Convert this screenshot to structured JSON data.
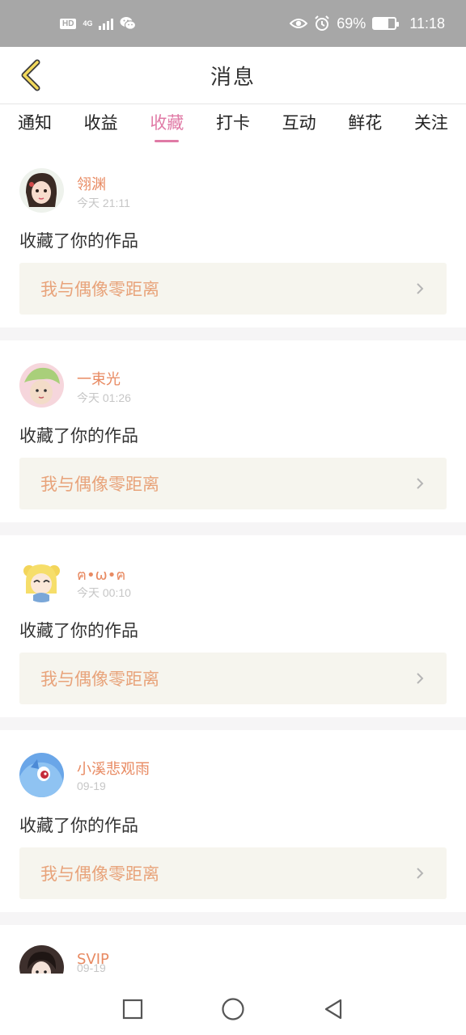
{
  "status_bar": {
    "hd": "HD",
    "network": "4G",
    "battery_text": "69%",
    "time": "11:18",
    "battery_level": 0.69,
    "icons": [
      "wechat-icon",
      "eye-icon",
      "alarm-icon",
      "battery-icon"
    ]
  },
  "header": {
    "title": "消息",
    "back_icon": "chevron-left-icon"
  },
  "tabs": [
    {
      "label": "通知",
      "active": false
    },
    {
      "label": "收益",
      "active": false
    },
    {
      "label": "收藏",
      "active": true
    },
    {
      "label": "打卡",
      "active": false
    },
    {
      "label": "互动",
      "active": false
    },
    {
      "label": "鲜花",
      "active": false
    },
    {
      "label": "关注",
      "active": false
    }
  ],
  "messages": [
    {
      "username": "翎渊",
      "time": "今天 21:11",
      "action": "收藏了你的作品",
      "work_title": "我与偶像零距离"
    },
    {
      "username": "一束光",
      "time": "今天 01:26",
      "action": "收藏了你的作品",
      "work_title": "我与偶像零距离"
    },
    {
      "username": "ฅ•ω•ฅ",
      "time": "今天 00:10",
      "action": "收藏了你的作品",
      "work_title": "我与偶像零距离"
    },
    {
      "username": "小溪悲观雨",
      "time": "09-19",
      "action": "收藏了你的作品",
      "work_title": "我与偶像零距离"
    },
    {
      "username": "SVIP",
      "time": "09-19"
    }
  ],
  "colors": {
    "accent": "#e07aa6",
    "username": "#e88a62",
    "work_title": "#e8a37a",
    "status_bar_bg": "#a7a7a7"
  },
  "nav_bar": {
    "icons": [
      "square-icon",
      "circle-icon",
      "triangle-back-icon"
    ]
  }
}
